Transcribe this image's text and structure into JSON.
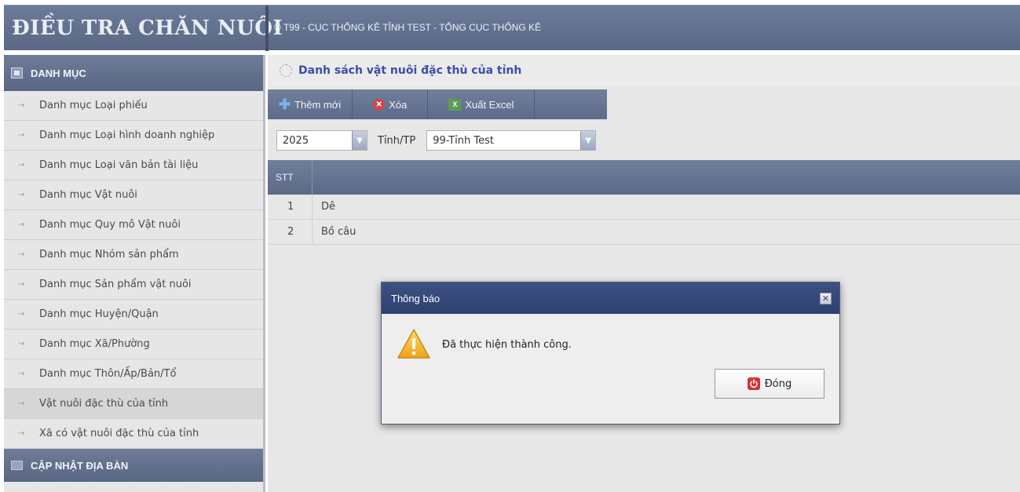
{
  "header": {
    "app_title": "ĐIỀU TRA CHĂN NUÔI",
    "org_line": "© T99 - CỤC THỐNG KÊ TỈNH TEST - TỔNG CỤC THỐNG KÊ"
  },
  "sidebar": {
    "section_title": "DANH MỤC",
    "items": [
      {
        "label": "Danh mục Loại phiếu"
      },
      {
        "label": "Danh mục Loại hình doanh nghiệp"
      },
      {
        "label": "Danh mục Loại văn bản tài liệu"
      },
      {
        "label": "Danh mục Vật nuôi"
      },
      {
        "label": "Danh mục Quy mô Vật nuôi"
      },
      {
        "label": "Danh mục Nhóm sản phẩm"
      },
      {
        "label": "Danh mục Sản phẩm vật nuôi"
      },
      {
        "label": "Danh mục Huyện/Quận"
      },
      {
        "label": "Danh mục Xã/Phường"
      },
      {
        "label": "Danh mục Thôn/Ấp/Bản/Tổ"
      },
      {
        "label": "Vật nuôi đặc thù của tỉnh"
      },
      {
        "label": "Xã có vật nuôi đặc thù của tỉnh"
      }
    ],
    "active_index": 10,
    "footer_title": "CẬP NHẬT ĐỊA BÀN"
  },
  "main": {
    "page_title": "Danh sách vật nuôi đặc thù của tỉnh",
    "toolbar": {
      "add_label": "Thêm mới",
      "delete_label": "Xóa",
      "export_label": "Xuất Excel"
    },
    "filters": {
      "year_value": "2025",
      "province_label": "Tỉnh/TP",
      "province_value": "99-Tỉnh Test"
    },
    "grid": {
      "col_stt": "STT",
      "rows": [
        {
          "stt": "1",
          "name": "Dê"
        },
        {
          "stt": "2",
          "name": "Bồ câu"
        }
      ]
    }
  },
  "dialog": {
    "title": "Thông báo",
    "message": "Đã thực hiện thành công.",
    "close_label": "Đóng"
  },
  "colors": {
    "header_bg": "#5f6d8b",
    "dialog_title_bg": "#34467a",
    "page_title": "#3a4ea8"
  }
}
